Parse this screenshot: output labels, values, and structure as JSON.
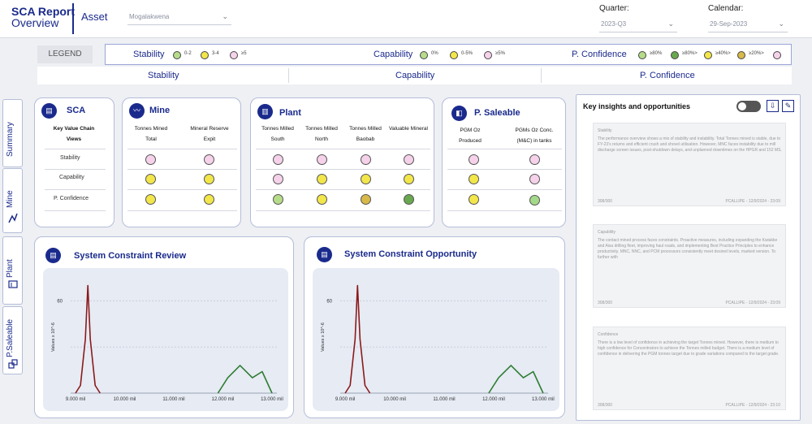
{
  "header": {
    "title": "SCA Report",
    "subtitle": "Overview",
    "asset_label": "Asset",
    "asset_value": "Mogalakwena",
    "quarter_label": "Quarter:",
    "quarter_value": "2023-Q3",
    "calendar_label": "Calendar:",
    "calendar_value": "29-Sep-2023"
  },
  "legend": {
    "tag": "LEGEND",
    "stability": {
      "label": "Stability",
      "items": [
        "0-2",
        "3-4",
        "≥5"
      ]
    },
    "capability": {
      "label": "Capability",
      "items": [
        "0%",
        "0-5%",
        "≥5%"
      ]
    },
    "confidence": {
      "label": "P. Confidence",
      "items": [
        "≥80%",
        "≥80%>",
        "≥40%>",
        "≥20%>"
      ]
    }
  },
  "tabs": [
    "Stability",
    "Capability",
    "P. Confidence"
  ],
  "sidenav": [
    "Summary",
    "Mine",
    "Plant",
    "P.Saleable"
  ],
  "sca": {
    "title": "SCA",
    "col_header": "Key Value Chain Views",
    "rows": [
      "Stability",
      "Capability",
      "P. Confidence"
    ]
  },
  "mine": {
    "title": "Mine",
    "cols": [
      "Tonnes Mined Total",
      "Mineral Reserve Expit"
    ]
  },
  "plant": {
    "title": "Plant",
    "cols": [
      "Tonnes Milled South",
      "Tonnes Milled North",
      "Tonnes Milled Baobab",
      "Valuable Mineral"
    ]
  },
  "saleable": {
    "title": "P. Saleable",
    "cols": [
      "PGM Oz Produced",
      "PGMs Oz Conc. (M&C) in tanks"
    ]
  },
  "charts": {
    "left_title": "System Constraint Review",
    "right_title": "System Constraint Opportunity",
    "ylabel": "Values x 10^-6",
    "ytick": "60",
    "xticks": [
      "9.000 mil",
      "10.000 mil",
      "11.000 mil",
      "12.000 mil",
      "13.000 mil"
    ]
  },
  "chart_data": [
    {
      "type": "line",
      "title": "System Constraint Review",
      "ylabel": "Values x 10^-6",
      "x_ticks": [
        "9.000 mil",
        "10.000 mil",
        "11.000 mil",
        "12.000 mil",
        "13.000 mil"
      ],
      "y_ticks": [
        60
      ],
      "series": [
        {
          "color": "#8b1a1a",
          "x": [
            9000000,
            9100000,
            9200000,
            9250000,
            9300000,
            9400000,
            9500000
          ],
          "y": [
            0,
            5,
            35,
            70,
            35,
            5,
            0
          ]
        },
        {
          "color": "#2e7d32",
          "x": [
            11900000,
            12100000,
            12350000,
            12600000,
            12800000,
            13000000
          ],
          "y": [
            0,
            10,
            18,
            10,
            14,
            0
          ]
        }
      ]
    },
    {
      "type": "line",
      "title": "System Constraint Opportunity",
      "ylabel": "Values x 10^-6",
      "x_ticks": [
        "9.000 mil",
        "10.000 mil",
        "11.000 mil",
        "12.000 mil",
        "13.000 mil"
      ],
      "y_ticks": [
        60
      ],
      "series": [
        {
          "color": "#8b1a1a",
          "x": [
            9000000,
            9100000,
            9200000,
            9250000,
            9300000,
            9400000,
            9500000
          ],
          "y": [
            0,
            5,
            35,
            70,
            35,
            5,
            0
          ]
        },
        {
          "color": "#2e7d32",
          "x": [
            11900000,
            12100000,
            12350000,
            12600000,
            12800000,
            13000000
          ],
          "y": [
            0,
            10,
            18,
            10,
            14,
            0
          ]
        }
      ]
    }
  ],
  "insights": {
    "title": "Key insights and opportunities",
    "sections": [
      {
        "label": "Stability",
        "text": "The performance overview shows a mix of stability and instability. Total Tonnes mined is stable, due to FY-23's returns and efficient crush and shovel utilisation. However, MNC faces instability due to mill discharge screen issues, post-shutdown delays, and unplanned downtimes on the HPGR and 152 MS.",
        "count": "308/300",
        "author": "PCALLIPE - 12/9/2024 - 23:09"
      },
      {
        "label": "Capability",
        "text": "The contact mined process faces constraints. Proactive measures, including expanding the Kwiakke and Aisa drilling fleet, improving haul roads, and implementing Best Practice Principles to enhance productivity. MNC, NNC, and PCM processors consistently meet desired levels, marked version. To further with",
        "count": "308/300",
        "author": "PCALLIPE - 12/9/2024 - 23:09"
      },
      {
        "label": "Confidence",
        "text": "There is a low level of confidence in achieving the target Tonnes mined. However, there is medium to high confidence for Concentrators to achieve the Tonnes milled budget. There is a medium level of confidence in delivering the PGM tonnes target due to grade variations compared to the target grade.",
        "count": "308/300",
        "author": "PCALLIPE - 12/9/2024 - 23:10"
      }
    ]
  }
}
